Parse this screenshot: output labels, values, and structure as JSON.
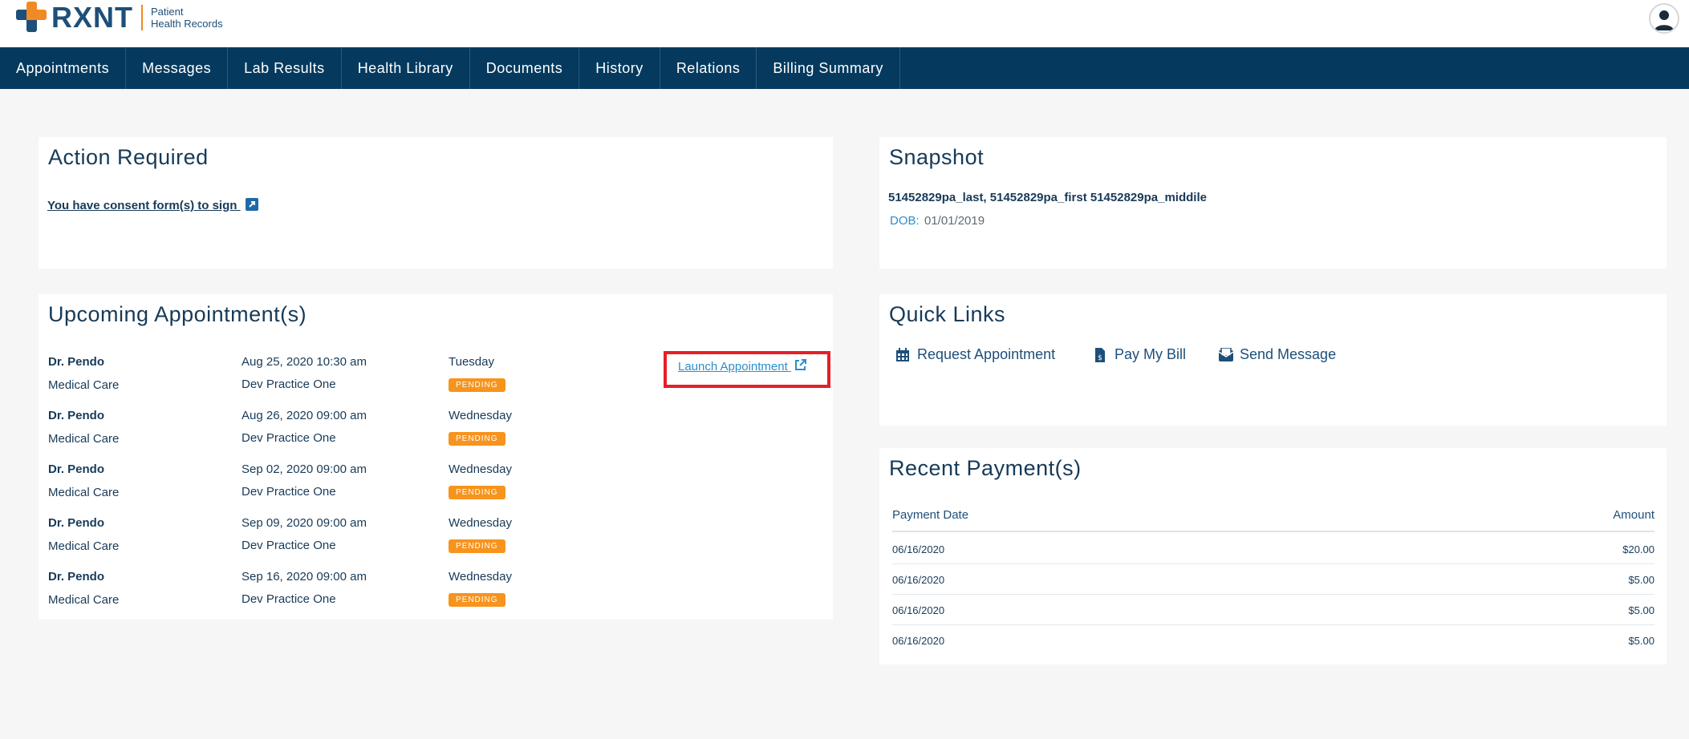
{
  "brand": {
    "name": "RXNT",
    "subtitle_line1": "Patient",
    "subtitle_line2": "Health Records"
  },
  "nav": [
    {
      "label": "Appointments"
    },
    {
      "label": "Messages"
    },
    {
      "label": "Lab Results"
    },
    {
      "label": "Health Library"
    },
    {
      "label": "Documents"
    },
    {
      "label": "History"
    },
    {
      "label": "Relations"
    },
    {
      "label": "Billing Summary"
    }
  ],
  "action_required": {
    "title": "Action Required",
    "consent_link": "You have consent form(s) to sign"
  },
  "upcoming": {
    "title": "Upcoming Appointment(s)",
    "launch_label": "Launch Appointment",
    "rows": [
      {
        "doctor": "Dr. Pendo",
        "type": "Medical Care",
        "datetime": "Aug 25, 2020 10:30 am",
        "practice": "Dev Practice One",
        "weekday": "Tuesday",
        "status": "PENDING"
      },
      {
        "doctor": "Dr. Pendo",
        "type": "Medical Care",
        "datetime": "Aug 26, 2020 09:00 am",
        "practice": "Dev Practice One",
        "weekday": "Wednesday",
        "status": "PENDING"
      },
      {
        "doctor": "Dr. Pendo",
        "type": "Medical Care",
        "datetime": "Sep 02, 2020 09:00 am",
        "practice": "Dev Practice One",
        "weekday": "Wednesday",
        "status": "PENDING"
      },
      {
        "doctor": "Dr. Pendo",
        "type": "Medical Care",
        "datetime": "Sep 09, 2020 09:00 am",
        "practice": "Dev Practice One",
        "weekday": "Wednesday",
        "status": "PENDING"
      },
      {
        "doctor": "Dr. Pendo",
        "type": "Medical Care",
        "datetime": "Sep 16, 2020 09:00 am",
        "practice": "Dev Practice One",
        "weekday": "Wednesday",
        "status": "PENDING"
      }
    ]
  },
  "snapshot": {
    "title": "Snapshot",
    "patient_name": "51452829pa_last, 51452829pa_first 51452829pa_middile",
    "dob_label": "DOB:",
    "dob_value": "01/01/2019"
  },
  "quick_links": {
    "title": "Quick Links",
    "items": [
      {
        "label": "Request Appointment",
        "icon": "calendar-icon"
      },
      {
        "label": "Pay My Bill",
        "icon": "bill-icon"
      },
      {
        "label": "Send Message",
        "icon": "envelope-icon"
      }
    ]
  },
  "payments": {
    "title": "Recent Payment(s)",
    "col_date": "Payment Date",
    "col_amount": "Amount",
    "rows": [
      {
        "date": "06/16/2020",
        "amount": "$20.00"
      },
      {
        "date": "06/16/2020",
        "amount": "$5.00"
      },
      {
        "date": "06/16/2020",
        "amount": "$5.00"
      },
      {
        "date": "06/16/2020",
        "amount": "$5.00"
      }
    ]
  },
  "colors": {
    "navbar": "#053a5e",
    "brand_orange": "#f08a24",
    "pending_badge": "#f7941d",
    "link_blue": "#2a8fca",
    "highlight_red": "#e61f26"
  }
}
